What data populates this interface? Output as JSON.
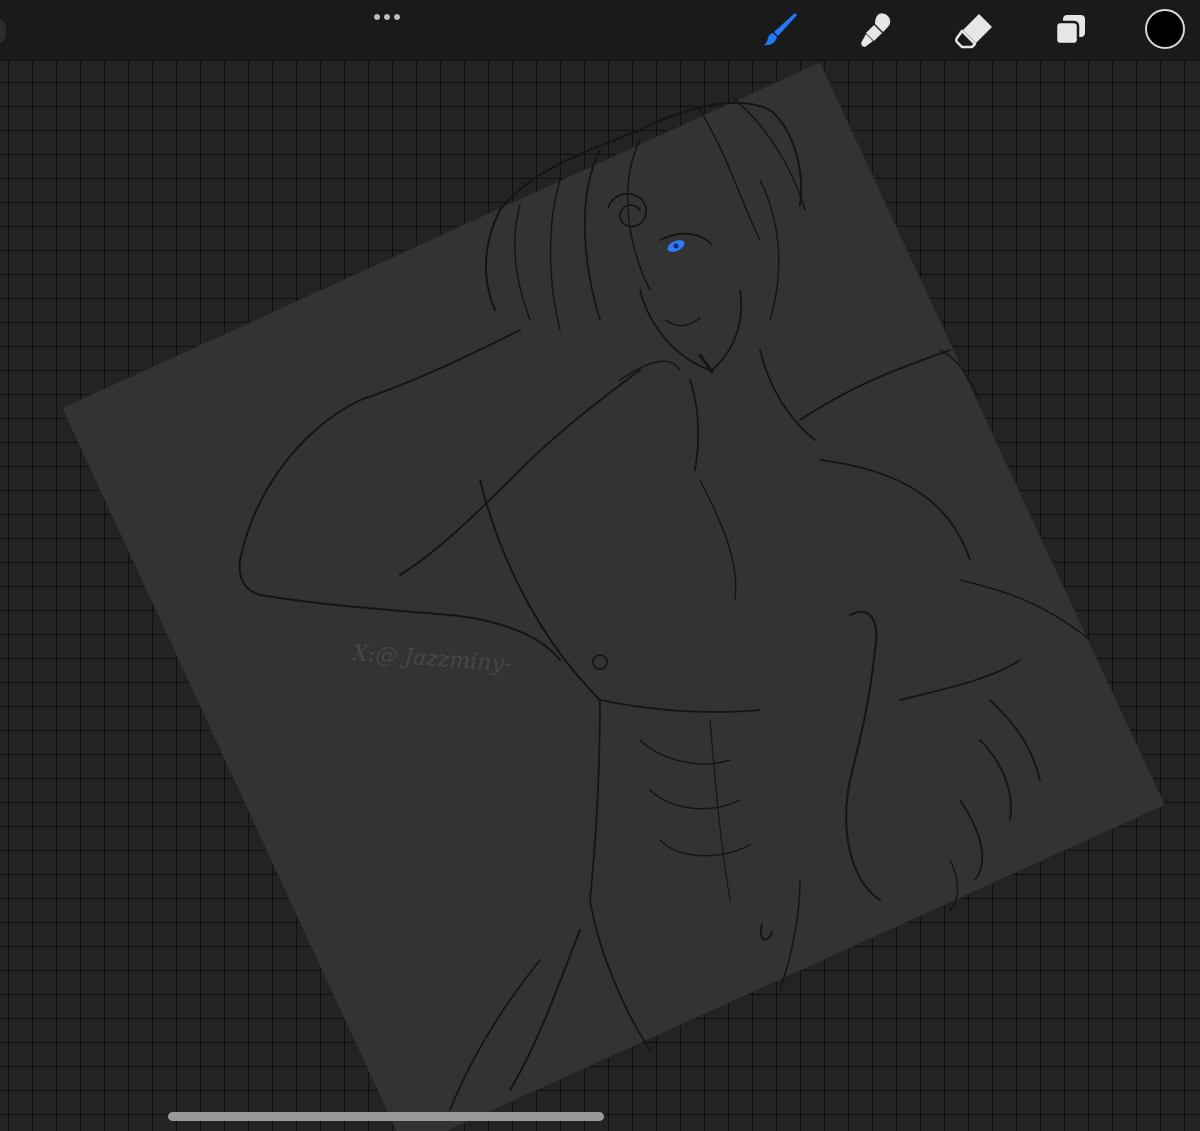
{
  "toolbar": {
    "more_icon": "ellipsis-icon",
    "tools": [
      {
        "name": "brush",
        "icon": "paintbrush-icon",
        "active": true,
        "color": "#1E7BFF"
      },
      {
        "name": "smudge",
        "icon": "smudge-finger-icon",
        "active": false,
        "color": "#E6E6E6"
      },
      {
        "name": "eraser",
        "icon": "eraser-icon",
        "active": false,
        "color": "#E6E6E6"
      },
      {
        "name": "layers",
        "icon": "layers-icon",
        "active": false,
        "color": "#E6E6E6"
      }
    ],
    "current_color": "#000000"
  },
  "canvas": {
    "watermark": "X:@ Jazzminy-",
    "paper_color": "#333333",
    "workspace_color": "#232323",
    "eye_color": "#2E7BFF"
  }
}
